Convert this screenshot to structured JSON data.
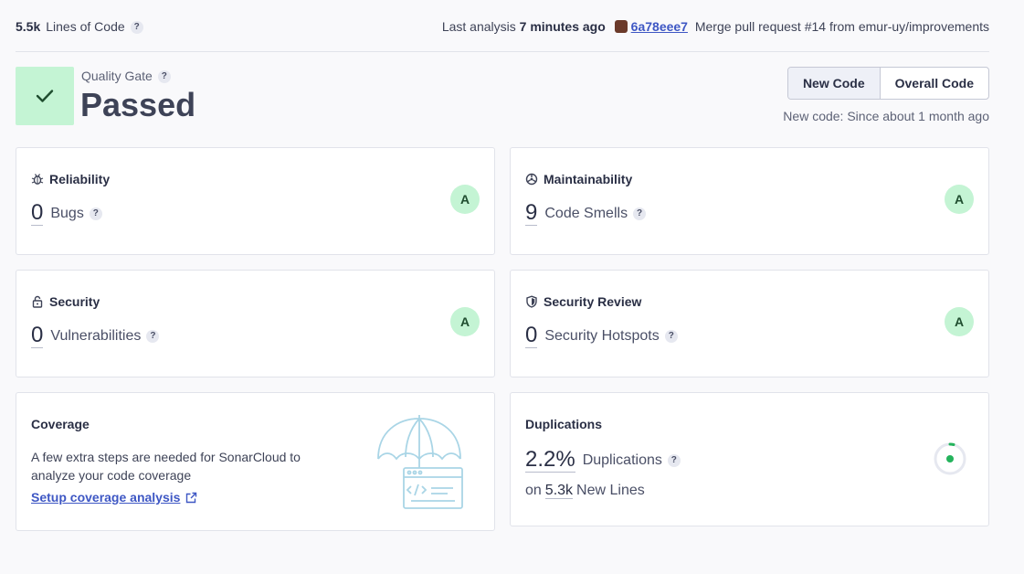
{
  "topbar": {
    "lines_value": "5.5k",
    "lines_label": "Lines of Code",
    "help": "?",
    "last_analysis_label": "Last analysis",
    "last_analysis_time": "7 minutes ago",
    "commit_hash": "6a78eee7",
    "commit_message": "Merge pull request #14 from emur-uy/improvements"
  },
  "quality_gate": {
    "label": "Quality Gate",
    "status": "Passed"
  },
  "period_toggle": {
    "new_code": "New Code",
    "overall_code": "Overall Code",
    "since": "New code: Since about 1 month ago"
  },
  "cards": {
    "reliability": {
      "title": "Reliability",
      "value": "0",
      "label": "Bugs",
      "grade": "A"
    },
    "maintainability": {
      "title": "Maintainability",
      "value": "9",
      "label": "Code Smells",
      "grade": "A"
    },
    "security": {
      "title": "Security",
      "value": "0",
      "label": "Vulnerabilities",
      "grade": "A"
    },
    "security_review": {
      "title": "Security Review",
      "value": "0",
      "label": "Security Hotspots",
      "grade": "A"
    },
    "coverage": {
      "title": "Coverage",
      "text": "A few extra steps are needed for SonarCloud to analyze your code coverage",
      "link": "Setup coverage analysis"
    },
    "duplications": {
      "title": "Duplications",
      "value": "2.2%",
      "label": "Duplications",
      "on": "on",
      "new_lines_value": "5.3k",
      "new_lines_label": "New Lines",
      "fraction": 0.022
    }
  },
  "colors": {
    "passed_bg": "#c4f4d4",
    "link": "#3e57c4",
    "dup_green": "#24b35c"
  }
}
